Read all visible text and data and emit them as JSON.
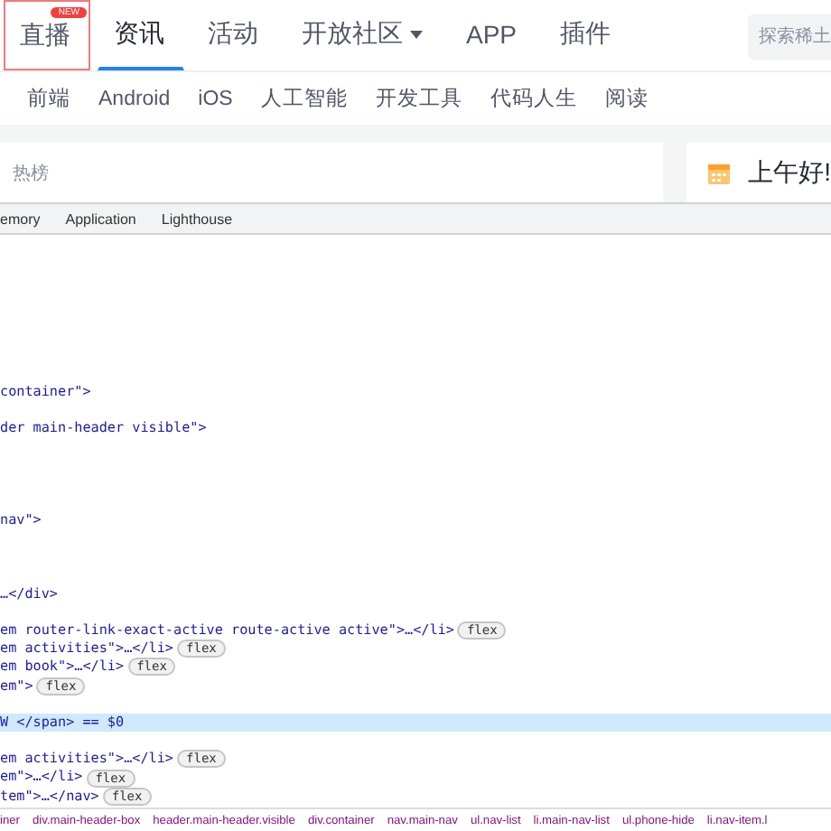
{
  "main_nav": {
    "items": [
      {
        "label": "直播",
        "selected": false,
        "badge": "NEW",
        "highlighted": true
      },
      {
        "label": "资讯",
        "selected": true,
        "highlighted": false
      },
      {
        "label": "活动",
        "selected": false,
        "highlighted": false
      },
      {
        "label": "开放社区",
        "selected": false,
        "highlighted": false,
        "dropdown": true
      },
      {
        "label": "APP",
        "selected": false,
        "highlighted": false
      },
      {
        "label": "插件",
        "selected": false,
        "highlighted": false
      }
    ],
    "search": {
      "placeholder": "探索稀土"
    }
  },
  "sub_nav": {
    "items": [
      "前端",
      "Android",
      "iOS",
      "人工智能",
      "开发工具",
      "代码人生",
      "阅读"
    ]
  },
  "content": {
    "hot_list_title": "热榜",
    "greeting": "上午好!"
  },
  "devtools": {
    "tabs": [
      "emory",
      "Application",
      "Lighthouse"
    ],
    "lines": [
      {
        "kind": "offscreen"
      },
      {
        "kind": "offscreen"
      },
      {
        "kind": "offscreen"
      },
      {
        "kind": "offscreen"
      },
      {
        "kind": "offscreen"
      },
      {
        "kind": "offscreen"
      },
      {
        "kind": "offscreen"
      },
      {
        "kind": "offscreen"
      },
      {
        "kind": "code",
        "text": " container\">",
        "selected": false
      },
      {
        "kind": "offscreen"
      },
      {
        "kind": "code",
        "text": "der main-header visible\">",
        "selected": false
      },
      {
        "kind": "offscreen"
      },
      {
        "kind": "offscreen"
      },
      {
        "kind": "offscreen"
      },
      {
        "kind": "offscreen"
      },
      {
        "kind": "code",
        "text": "nav\">",
        "selected": false
      },
      {
        "kind": "offscreen"
      },
      {
        "kind": "offscreen"
      },
      {
        "kind": "offscreen"
      },
      {
        "kind": "code",
        "text": "…</div>",
        "selected": false
      },
      {
        "kind": "offscreen"
      },
      {
        "kind": "code",
        "text": "em router-link-exact-active route-active active\">…</li>",
        "badge": "flex",
        "selected": false
      },
      {
        "kind": "code",
        "text": "em activities\">…</li>",
        "badge": "flex",
        "selected": false
      },
      {
        "kind": "code",
        "text": "em book\">…</li>",
        "badge": "flex",
        "selected": false
      },
      {
        "kind": "code",
        "text": "em\">",
        "badge": "flex",
        "selected": false
      },
      {
        "kind": "offscreen"
      },
      {
        "kind": "code",
        "text": "W </span> == $0",
        "selected": true
      },
      {
        "kind": "offscreen"
      },
      {
        "kind": "code",
        "text": "em activities\">…</li>",
        "badge": "flex",
        "selected": false
      },
      {
        "kind": "code",
        "text": "em\">…</li>",
        "badge": "flex",
        "selected": false
      },
      {
        "kind": "code",
        "text": "tem\">…</nav>",
        "badge": "flex",
        "selected": false
      }
    ],
    "breadcrumbs": [
      "iner",
      "div.main-header-box",
      "header.main-header.visible",
      "div.container",
      "nav.main-nav",
      "ul.nav-list",
      "li.main-nav-list",
      "ul.phone-hide",
      "li.nav-item.l"
    ]
  }
}
